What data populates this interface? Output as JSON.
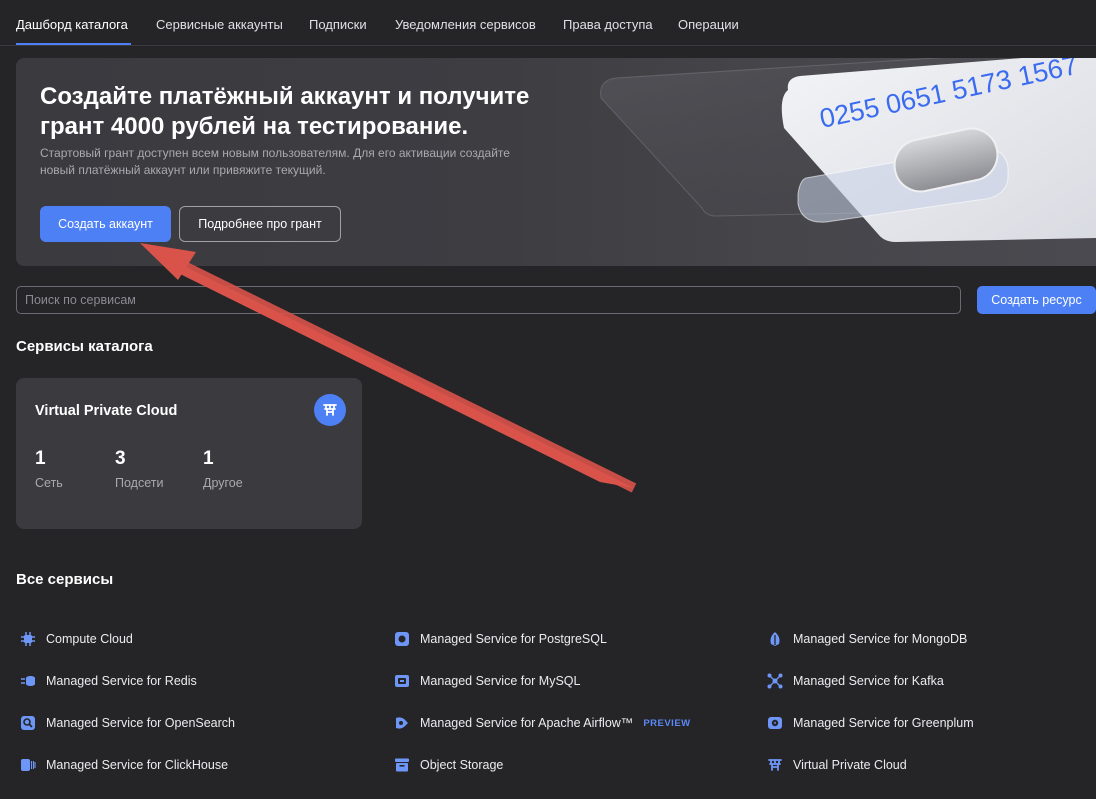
{
  "tabs": [
    {
      "label": "Дашборд каталога",
      "active": true
    },
    {
      "label": "Сервисные аккаунты"
    },
    {
      "label": "Подписки"
    },
    {
      "label": "Уведомления сервисов"
    },
    {
      "label": "Права доступа"
    },
    {
      "label": "Операции"
    }
  ],
  "banner": {
    "title": "Создайте платёжный аккаунт и получите грант 4000 рублей на тестирование.",
    "subtitle": "Стартовый грант доступен всем новым пользователям. Для его активации создайте новый платёжный аккаунт или привяжите текущий.",
    "primary_button": "Создать аккаунт",
    "secondary_button": "Подробнее про грант",
    "card_number": "0255 0651 5173 1567"
  },
  "search": {
    "placeholder": "Поиск по сервисам",
    "value": "",
    "create_button": "Создать ресурс"
  },
  "catalog": {
    "title": "Сервисы каталога",
    "vpc_card": {
      "title": "Virtual Private Cloud",
      "icon": "vpc-icon",
      "stats": [
        {
          "value": "1",
          "label": "Сеть"
        },
        {
          "value": "3",
          "label": "Подсети"
        },
        {
          "value": "1",
          "label": "Другое"
        }
      ]
    }
  },
  "all_services": {
    "title": "Все сервисы",
    "items": [
      {
        "label": "Compute Cloud",
        "icon": "compute-cloud-icon"
      },
      {
        "label": "Managed Service for PostgreSQL",
        "icon": "postgresql-icon"
      },
      {
        "label": "Managed Service for MongoDB",
        "icon": "mongodb-icon"
      },
      {
        "label": "Managed Service for Redis",
        "icon": "redis-icon"
      },
      {
        "label": "Managed Service for MySQL",
        "icon": "mysql-icon"
      },
      {
        "label": "Managed Service for Kafka",
        "icon": "kafka-icon"
      },
      {
        "label": "Managed Service for OpenSearch",
        "icon": "opensearch-icon"
      },
      {
        "label": "Managed Service for Apache Airflow™",
        "icon": "airflow-icon",
        "badge": "PREVIEW"
      },
      {
        "label": "Managed Service for Greenplum",
        "icon": "greenplum-icon"
      },
      {
        "label": "Managed Service for ClickHouse",
        "icon": "clickhouse-icon"
      },
      {
        "label": "Object Storage",
        "icon": "object-storage-icon"
      },
      {
        "label": "Virtual Private Cloud",
        "icon": "vpc-icon"
      }
    ]
  },
  "colors": {
    "background": "#252528",
    "accent": "#4d7ff5",
    "card": "#3a3a3f",
    "arrow": "#d9534a"
  }
}
